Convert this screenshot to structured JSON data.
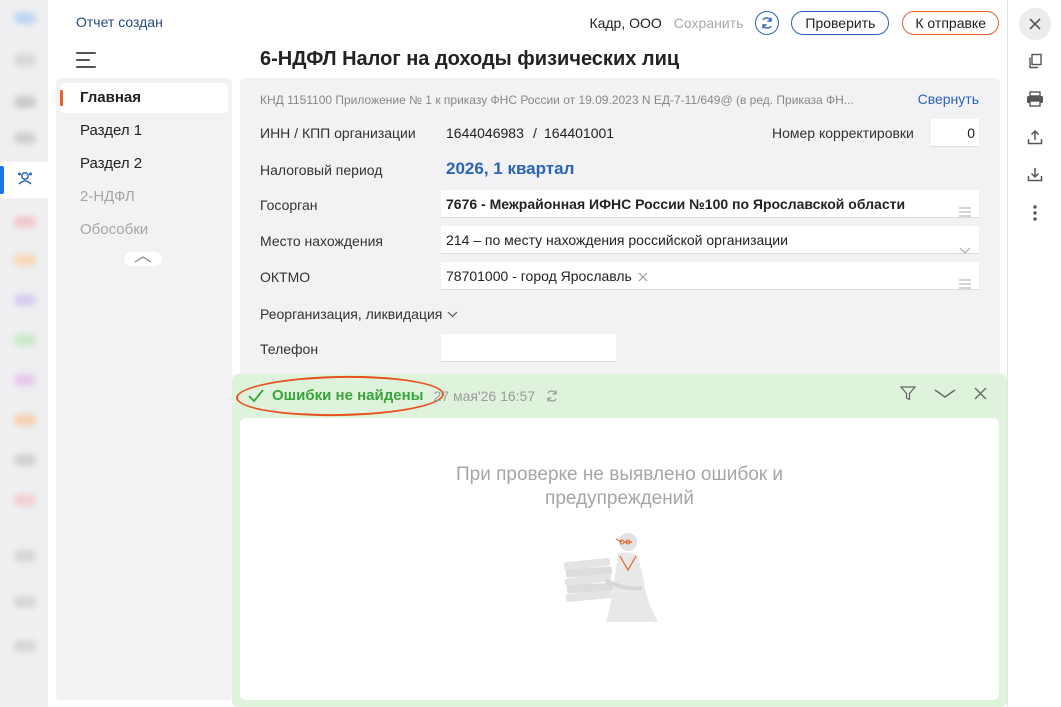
{
  "header": {
    "report_status": "Отчет создан",
    "page_title": "6-НДФЛ Налог на доходы физических лиц",
    "org_name": "Кадр, ООО",
    "save_label": "Сохранить",
    "check_label": "Проверить",
    "send_label": "К отправке"
  },
  "sidebar": {
    "items": [
      {
        "label": "Главная",
        "state": "active"
      },
      {
        "label": "Раздел 1",
        "state": "normal"
      },
      {
        "label": "Раздел 2",
        "state": "normal"
      },
      {
        "label": "2-НДФЛ",
        "state": "disabled"
      },
      {
        "label": "Обособки",
        "state": "disabled"
      }
    ]
  },
  "form": {
    "knd_text": "КНД 1151100 Приложение № 1 к приказу ФНС России от 19.09.2023 N ЕД-7-11/649@ (в ред. Приказа ФН...",
    "collapse_label": "Свернуть",
    "inn_kpp_label": "ИНН / КПП организации",
    "inn": "1644046983",
    "kpp_sep": "/",
    "kpp": "164401001",
    "correction_label": "Номер корректировки",
    "correction_value": "0",
    "period_label": "Налоговый период",
    "period_value": "2026, 1 квартал",
    "authority_label": "Госорган",
    "authority_value": "7676 - Межрайонная ИФНС России №100 по Ярославской области",
    "location_label": "Место нахождения",
    "location_value": "214 – по месту нахождения российской организации",
    "oktmo_label": "ОКТМО",
    "oktmo_value": "78701000 - город Ярославль",
    "reorg_label": "Реорганизация, ликвидация",
    "phone_label": "Телефон",
    "phone_value": ""
  },
  "check_result": {
    "title": "Ошибки не найдены",
    "timestamp": "27 мая'26 16:57",
    "empty_message_line1": "При проверке не выявлено ошибок и",
    "empty_message_line2": "предупреждений"
  },
  "icons": {
    "left_active": "org-chart-icon",
    "right_toolbar": [
      "close-icon",
      "copy-icon",
      "print-icon",
      "upload-icon",
      "download-icon",
      "more-vertical-icon"
    ]
  },
  "colors": {
    "accent_blue": "#2b63b8",
    "accent_orange": "#e8612d",
    "success_green": "#3aa33a",
    "result_bg": "#dff3dc"
  }
}
